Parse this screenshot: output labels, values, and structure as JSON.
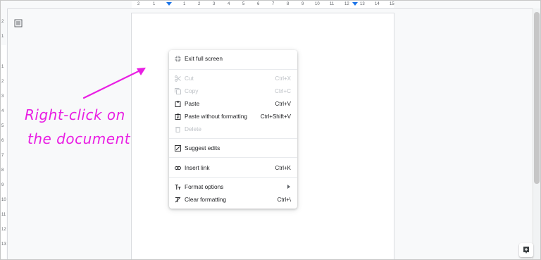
{
  "ruler": {
    "top_numbers": [
      "2",
      "1",
      "1",
      "2",
      "3",
      "4",
      "5",
      "6",
      "7",
      "8",
      "9",
      "10",
      "11",
      "12",
      "13",
      "14",
      "15"
    ],
    "left_numbers": [
      "2",
      "1",
      "1",
      "2",
      "3",
      "4",
      "5",
      "6",
      "7",
      "8",
      "9",
      "10",
      "11",
      "12",
      "13"
    ]
  },
  "annotation": {
    "line1": "Right-click on",
    "line2": "the document",
    "color": "#e91ee3"
  },
  "context_menu": {
    "items": [
      {
        "label": "Exit full screen",
        "shortcut": "",
        "icon": "exit-fullscreen-icon",
        "disabled": false
      },
      {
        "label": "Cut",
        "shortcut": "Ctrl+X",
        "icon": "scissors-icon",
        "disabled": true
      },
      {
        "label": "Copy",
        "shortcut": "Ctrl+C",
        "icon": "copy-icon",
        "disabled": true
      },
      {
        "label": "Paste",
        "shortcut": "Ctrl+V",
        "icon": "clipboard-icon",
        "disabled": false
      },
      {
        "label": "Paste without formatting",
        "shortcut": "Ctrl+Shift+V",
        "icon": "paste-plain-icon",
        "disabled": false
      },
      {
        "label": "Delete",
        "shortcut": "",
        "icon": "trash-icon",
        "disabled": true
      },
      {
        "label": "Suggest edits",
        "shortcut": "",
        "icon": "suggest-edit-icon",
        "disabled": false
      },
      {
        "label": "Insert link",
        "shortcut": "Ctrl+K",
        "icon": "link-icon",
        "disabled": false
      },
      {
        "label": "Format options",
        "shortcut": "",
        "icon": "text-format-icon",
        "disabled": false
      },
      {
        "label": "Clear formatting",
        "shortcut": "Ctrl+\\",
        "icon": "clear-format-icon",
        "disabled": false
      }
    ]
  },
  "colors": {
    "accent": "#1a73e8",
    "annotation": "#e91ee3"
  }
}
